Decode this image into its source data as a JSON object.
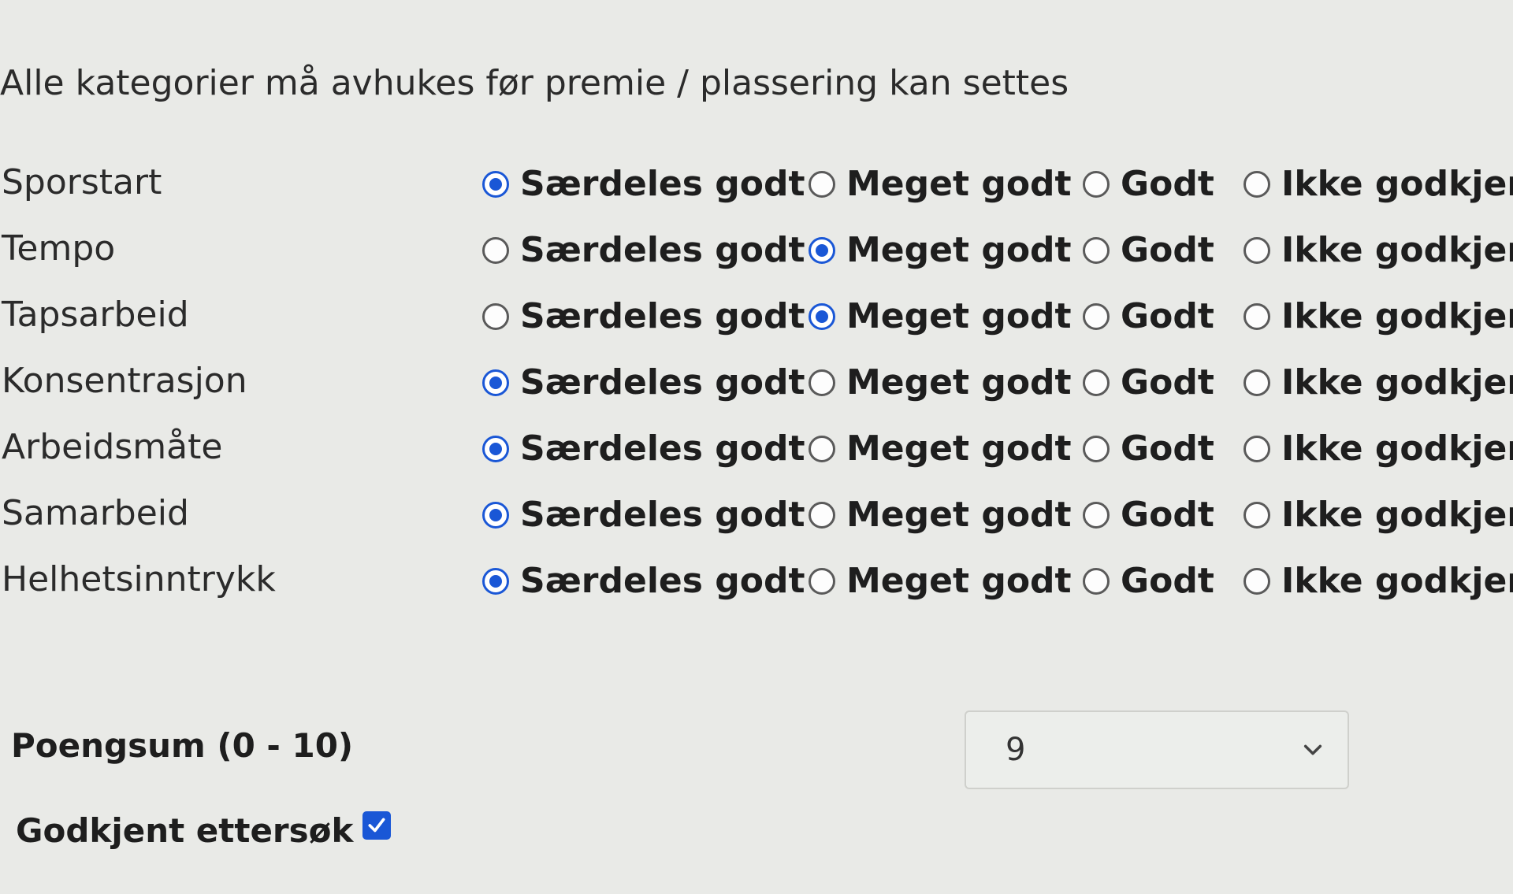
{
  "instruction": "Alle kategorier må avhukes før premie / plassering kan settes",
  "options": [
    "Særdeles godt",
    "Meget godt",
    "Godt",
    "Ikke godkjent"
  ],
  "categories": [
    {
      "label": "Sporstart",
      "selected": 0
    },
    {
      "label": "Tempo",
      "selected": 1
    },
    {
      "label": "Tapsarbeid",
      "selected": 1
    },
    {
      "label": "Konsentrasjon",
      "selected": 0
    },
    {
      "label": "Arbeidsmåte",
      "selected": 0
    },
    {
      "label": "Samarbeid",
      "selected": 0
    },
    {
      "label": "Helhetsinntrykk",
      "selected": 0
    }
  ],
  "score": {
    "label": "Poengsum (0 - 10)",
    "value": "9",
    "icon": "chevron-down-icon"
  },
  "approved": {
    "label": "Godkjent ettersøk",
    "checked": true,
    "icon": "checkmark-icon"
  },
  "colors": {
    "accent": "#1a57d6",
    "background": "#e9eae7"
  }
}
